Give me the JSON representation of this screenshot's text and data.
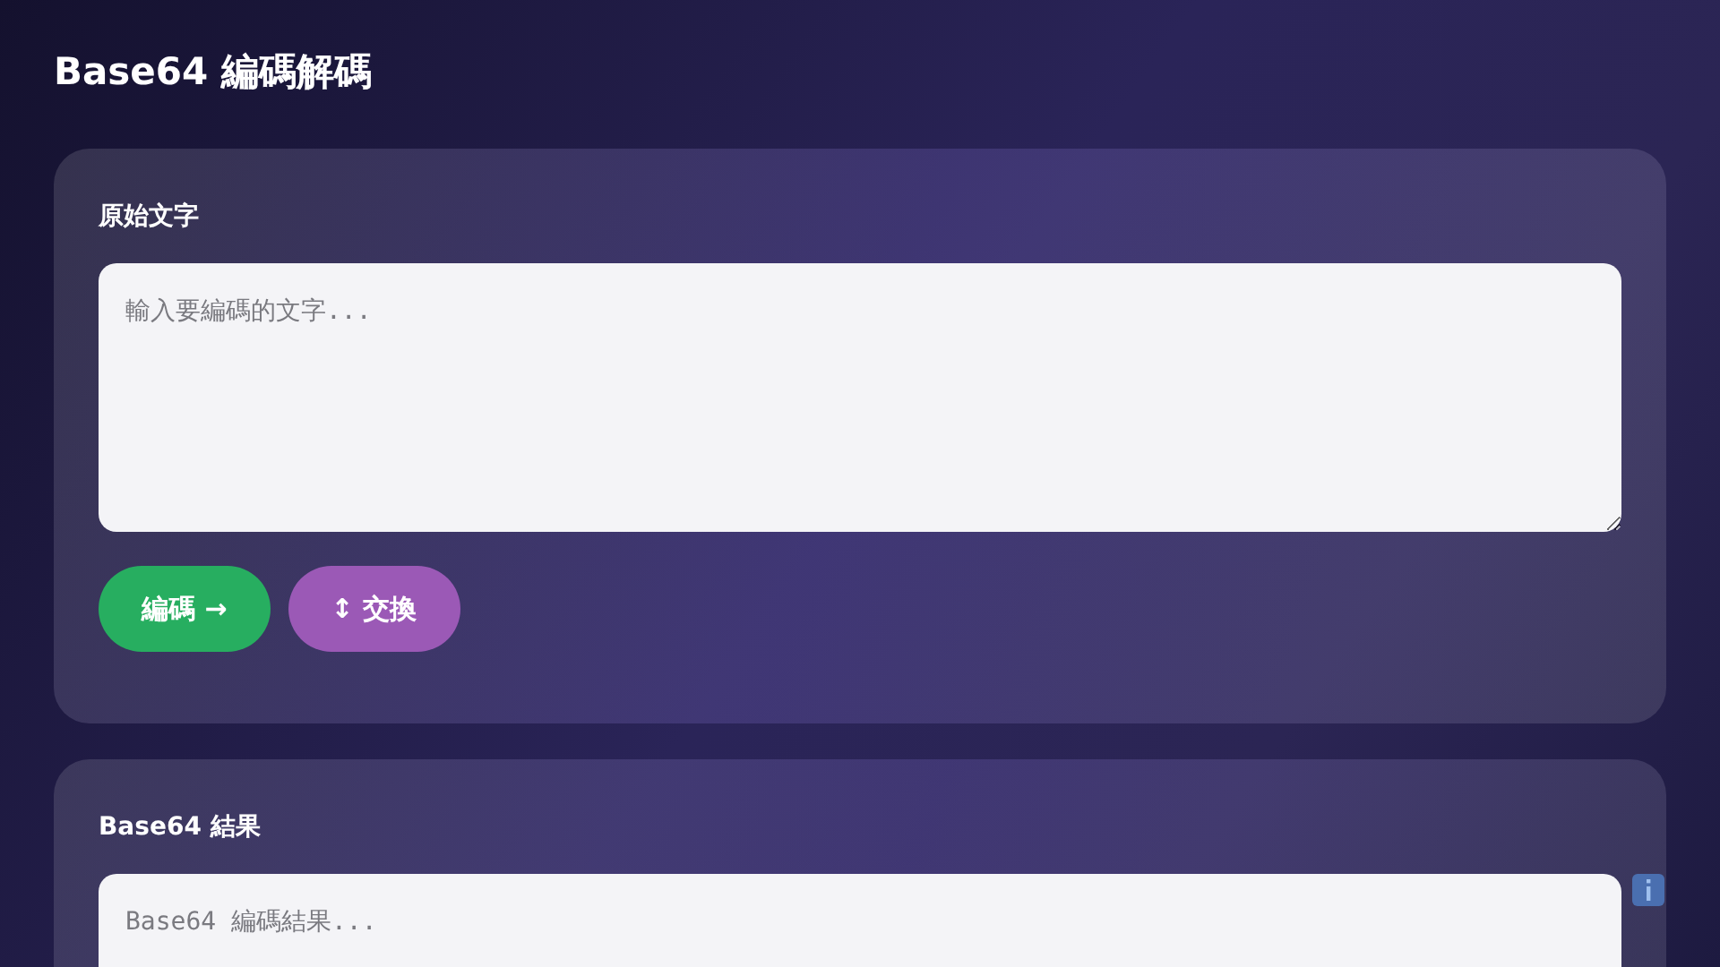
{
  "title": "Base64 編碼解碼",
  "input_panel": {
    "label": "原始文字",
    "placeholder": "輸入要編碼的文字...",
    "buttons": [
      {
        "kind": "encode",
        "label": "編碼 →"
      },
      {
        "kind": "swap",
        "label": "↕ 交換"
      }
    ]
  },
  "output_panel": {
    "label": "Base64 結果",
    "placeholder": "Base64 編碼結果..."
  }
}
